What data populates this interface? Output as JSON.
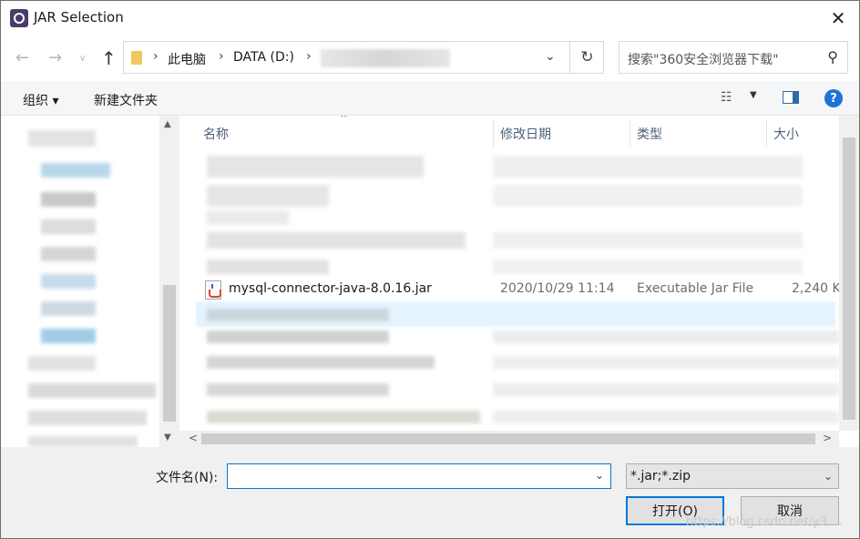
{
  "window": {
    "title": "JAR Selection"
  },
  "nav": {
    "breadcrumbs": [
      "此电脑",
      "DATA (D:)"
    ],
    "search_placeholder": "搜索\"360安全浏览器下载\""
  },
  "toolbar": {
    "organize": "组织",
    "new_folder": "新建文件夹"
  },
  "columns": {
    "name": "名称",
    "modified": "修改日期",
    "type": "类型",
    "size": "大小"
  },
  "file": {
    "name": "mysql-connector-java-8.0.16.jar",
    "modified": "2020/10/29 11:14",
    "type": "Executable Jar File",
    "size": "2,240 K"
  },
  "footer": {
    "filename_label": "文件名(N):",
    "filename_value": "",
    "filter_value": "*.jar;*.zip",
    "open_label": "打开(O)",
    "cancel_label": "取消",
    "watermark": "https://blog.csdn.net/y3...."
  },
  "icons": [
    "app-icon",
    "close-icon",
    "back-arrow-icon",
    "forward-arrow-icon",
    "up-arrow-icon",
    "folder-icon",
    "refresh-icon",
    "search-icon",
    "view-menu-icon",
    "preview-pane-icon",
    "help-icon",
    "jar-file-icon"
  ],
  "colors": {
    "accent": "#0078d7",
    "selection": "#e5f3ff",
    "help": "#1e74d6"
  }
}
